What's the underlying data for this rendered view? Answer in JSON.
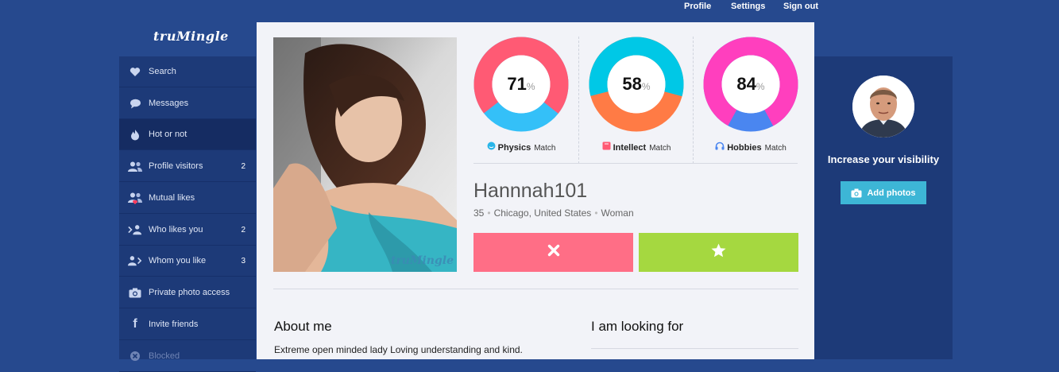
{
  "topnav": {
    "profile": "Profile",
    "settings": "Settings",
    "signout": "Sign out"
  },
  "brand": {
    "logo": "truMingle"
  },
  "sidebar": {
    "items": [
      {
        "label": "Search",
        "icon": "heart-icon",
        "count": ""
      },
      {
        "label": "Messages",
        "icon": "chat-bubble-icon",
        "count": ""
      },
      {
        "label": "Hot or not",
        "icon": "flame-icon",
        "count": ""
      },
      {
        "label": "Profile visitors",
        "icon": "users-icon",
        "count": "2"
      },
      {
        "label": "Mutual likes",
        "icon": "mutual-likes-icon",
        "count": ""
      },
      {
        "label": "Who likes you",
        "icon": "user-incoming-icon",
        "count": "2"
      },
      {
        "label": "Whom you like",
        "icon": "user-outgoing-icon",
        "count": "3"
      },
      {
        "label": "Private photo access",
        "icon": "camera-icon",
        "count": ""
      },
      {
        "label": "Invite friends",
        "icon": "facebook-icon",
        "count": ""
      },
      {
        "label": "Blocked",
        "icon": "blocked-icon",
        "count": ""
      }
    ]
  },
  "profile": {
    "photo_watermark": "truMingle",
    "name": "Hannnah101",
    "age": "35",
    "location": "Chicago, United States",
    "gender": "Woman"
  },
  "matches": [
    {
      "label": "Physics",
      "suffix": "Match",
      "value": 71,
      "unit": "%",
      "main_color": "#ff5a74",
      "rest_color": "#34c0f8",
      "icon": "face-icon",
      "icon_color": "#29b5e8"
    },
    {
      "label": "Intellect",
      "suffix": "Match",
      "value": 58,
      "unit": "%",
      "main_color": "#00c8e6",
      "rest_color": "#ff7b45",
      "icon": "book-icon",
      "icon_color": "#ff5a74"
    },
    {
      "label": "Hobbies",
      "suffix": "Match",
      "value": 84,
      "unit": "%",
      "main_color": "#ff3fbe",
      "rest_color": "#4a86f0",
      "icon": "headphones-icon",
      "icon_color": "#4a86f0"
    }
  ],
  "actions": {
    "reject_icon": "close-icon",
    "like_icon": "star-icon"
  },
  "sections": {
    "about_title": "About me",
    "about_text": "Extreme open minded lady Loving understanding and kind.",
    "looking_title": "I am looking for"
  },
  "right_panel": {
    "visibility_text": "Increase your visibility",
    "add_photos": "Add photos"
  },
  "colors": {
    "page_bg": "#26498e",
    "sidebar_bg": "#1d3a78",
    "reject": "#ff6e86",
    "like": "#a5d840",
    "add_photos": "#3db6d6"
  }
}
